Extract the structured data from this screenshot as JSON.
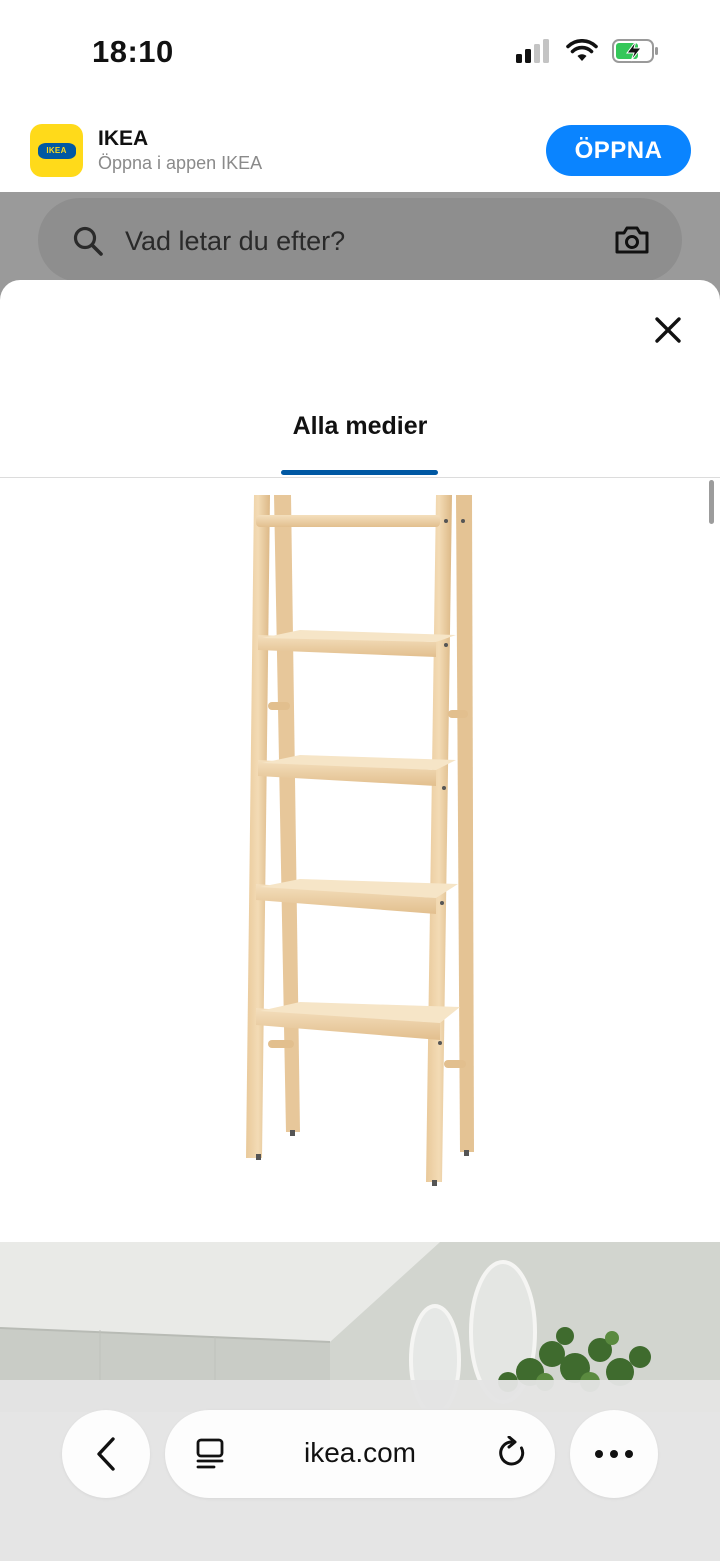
{
  "status_bar": {
    "time": "18:10",
    "signal_icon": "cellular-signal-icon",
    "wifi_icon": "wifi-icon",
    "battery_icon": "battery-charging-icon"
  },
  "app_banner": {
    "app_name": "IKEA",
    "subtitle": "Öppna i appen IKEA",
    "open_label": "ÖPPNA",
    "logo_text": "IKEA",
    "colors": {
      "icon_bg": "#ffda1a",
      "logo_blue": "#0058a3",
      "button": "#0a84ff"
    }
  },
  "search": {
    "placeholder": "Vad letar du efter?",
    "search_icon": "search-icon",
    "camera_icon": "camera-icon"
  },
  "media_viewer": {
    "close_icon": "close-icon",
    "tabs": [
      {
        "label": "Alla medier",
        "active": true
      }
    ],
    "accent_color": "#0058a3",
    "items": [
      {
        "kind": "product-image",
        "subject": "wooden-ladder-shelf"
      },
      {
        "kind": "room-image",
        "subject": "bathroom-with-mirrors-and-plant"
      }
    ]
  },
  "browser_toolbar": {
    "url": "ikea.com",
    "back_icon": "chevron-left-icon",
    "tabs_icon": "tabs-icon",
    "reload_icon": "reload-icon",
    "more_icon": "more-icon"
  }
}
